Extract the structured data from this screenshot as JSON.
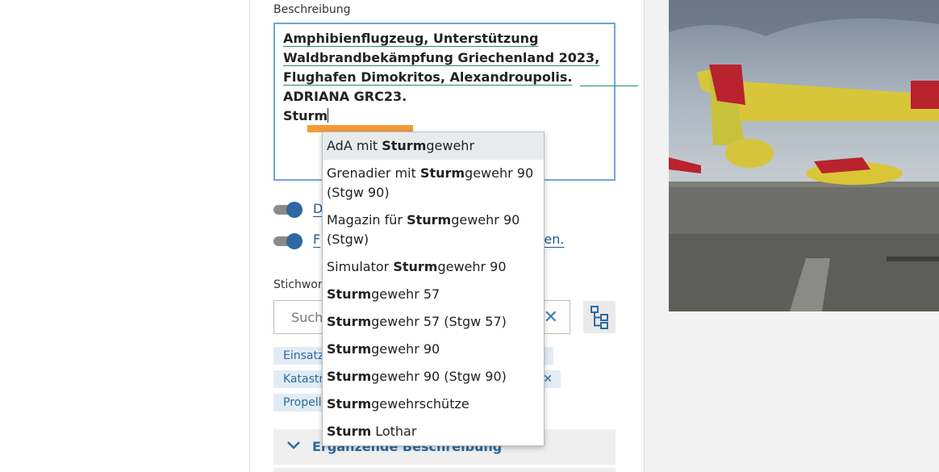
{
  "form": {
    "description_label": "Beschreibung",
    "description_lines": [
      "Amphibienflugzeug, Unterstützung",
      "Waldbrandbekämpfung Griechenland 2023,",
      "Flughafen Dimokritos, Alexandroupolis.",
      "ADRIANA GRC23.",
      "Sturm"
    ],
    "toggle1_text": "D",
    "toggle2_text_start": "F",
    "toggle2_text_end": "zen.",
    "keywords_label": "Stichwort",
    "search_placeholder": "Such",
    "tags": [
      {
        "label": "Einsatz"
      },
      {
        "label": "Katastr"
      },
      {
        "label": "Propell"
      }
    ],
    "accordion_title": "Ergänzende Beschreibung"
  },
  "autocomplete": {
    "query": "Sturm",
    "items": [
      {
        "prefix": "AdA mit ",
        "match": "Sturm",
        "suffix": "gewehr",
        "line2": ""
      },
      {
        "prefix": "Grenadier mit ",
        "match": "Sturm",
        "suffix": "gewehr 90",
        "line2": "(Stgw 90)"
      },
      {
        "prefix": "Magazin für ",
        "match": "Sturm",
        "suffix": "gewehr 90",
        "line2": "(Stgw)"
      },
      {
        "prefix": "Simulator ",
        "match": "Sturm",
        "suffix": "gewehr 90",
        "line2": ""
      },
      {
        "prefix": "",
        "match": "Sturm",
        "suffix": "gewehr 57",
        "line2": ""
      },
      {
        "prefix": "",
        "match": "Sturm",
        "suffix": "gewehr 57 (Stgw 57)",
        "line2": ""
      },
      {
        "prefix": "",
        "match": "Sturm",
        "suffix": "gewehr 90",
        "line2": ""
      },
      {
        "prefix": "",
        "match": "Sturm",
        "suffix": "gewehr 90 (Stgw 90)",
        "line2": ""
      },
      {
        "prefix": "",
        "match": "Sturm",
        "suffix": "gewehrschütze",
        "line2": ""
      },
      {
        "prefix": "",
        "match": "Sturm",
        "suffix": " Lothar",
        "line2": ""
      }
    ]
  },
  "icons": {
    "clear": "close-icon",
    "tree": "tree-hierarchy-icon",
    "chevron": "chevron-down-icon"
  },
  "colors": {
    "accent": "#2c6aa1",
    "focus_border": "#6fa6d9",
    "highlight": "#f29a38"
  }
}
